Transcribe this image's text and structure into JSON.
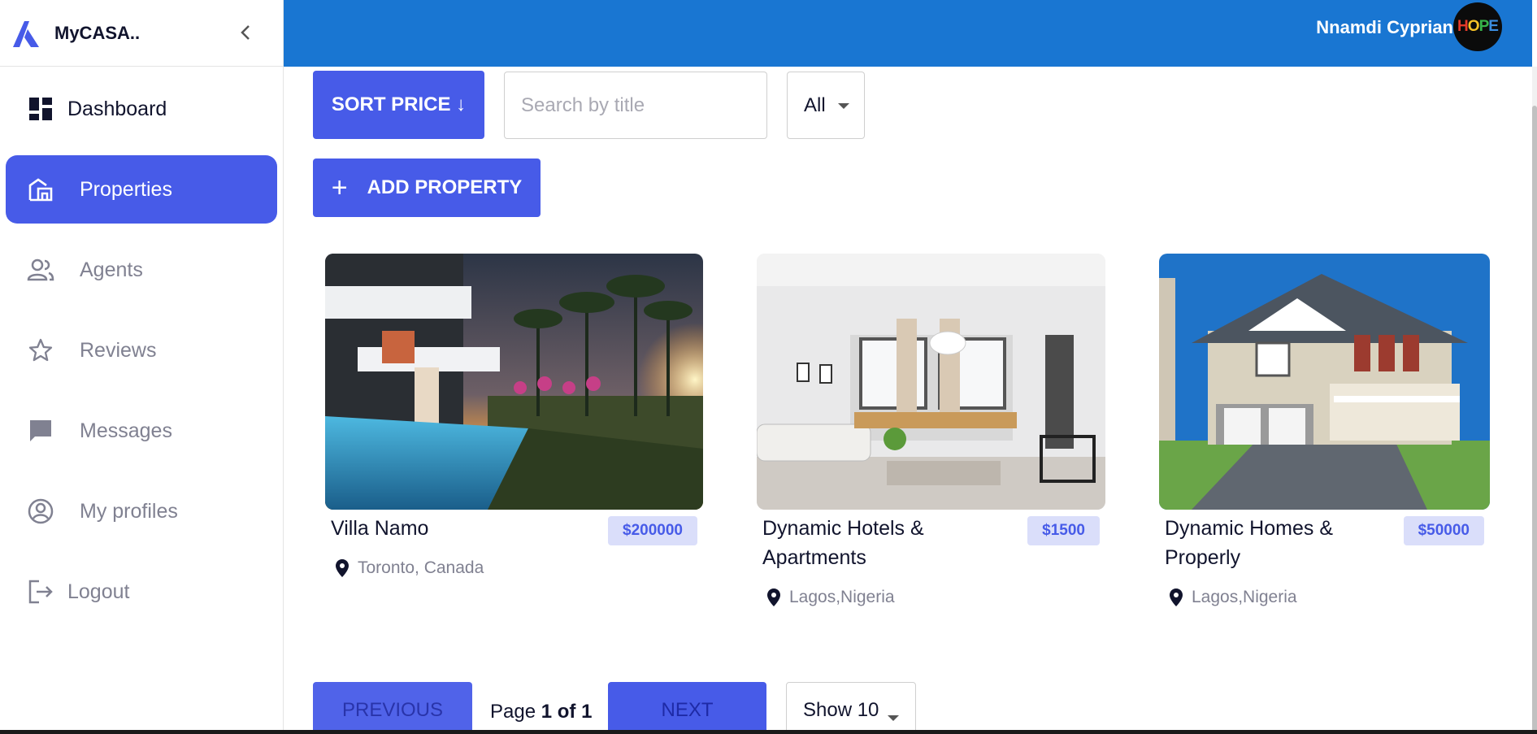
{
  "brand": {
    "name": "MyCASA.."
  },
  "sidebar": {
    "items": [
      {
        "label": "Dashboard",
        "icon": "dashboard-icon"
      },
      {
        "label": "Properties",
        "icon": "properties-icon"
      },
      {
        "label": "Agents",
        "icon": "agents-icon"
      },
      {
        "label": "Reviews",
        "icon": "star-icon"
      },
      {
        "label": "Messages",
        "icon": "messages-icon"
      },
      {
        "label": "My profiles",
        "icon": "profile-icon"
      },
      {
        "label": "Logout",
        "icon": "logout-icon"
      }
    ],
    "active": "Properties"
  },
  "header": {
    "username": "Nnamdi Cyprian",
    "avatar_text": [
      "H",
      "O",
      "P",
      "E"
    ]
  },
  "toolbar": {
    "sort_label": "SORT PRICE ↓",
    "search_placeholder": "Search by title",
    "filter_value": "All",
    "add_label": "ADD PROPERTY"
  },
  "properties": [
    {
      "title": "Villa Namo",
      "price": "$200000",
      "location": "Toronto, Canada"
    },
    {
      "title": "Dynamic Hotels & Apartments",
      "price": "$1500",
      "location": "Lagos,Nigeria"
    },
    {
      "title": "Dynamic Homes & Properly",
      "price": "$50000",
      "location": "Lagos,Nigeria"
    }
  ],
  "pagination": {
    "prev_label": "PREVIOUS",
    "next_label": "NEXT",
    "page_prefix": "Page",
    "page_value": "1 of 1",
    "show_label": "Show 10"
  },
  "colors": {
    "primary": "#475be8",
    "topbar": "#1976d2",
    "price_bg": "#dadefa"
  }
}
